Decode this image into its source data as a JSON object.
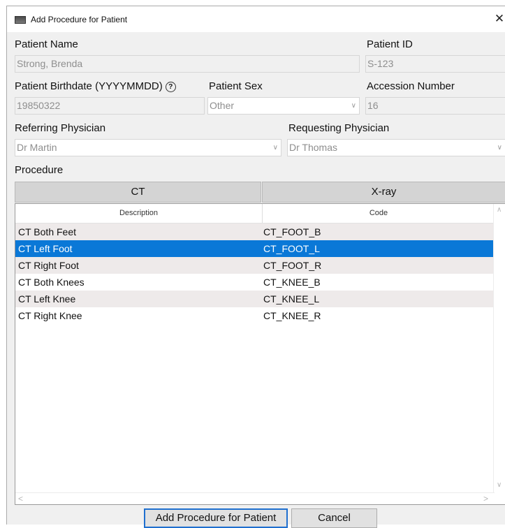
{
  "window": {
    "title": "Add Procedure for Patient",
    "close_glyph": "✕"
  },
  "patient": {
    "name_label": "Patient Name",
    "name_value": "Strong, Brenda",
    "id_label": "Patient ID",
    "id_value": "S-123",
    "birthdate_label": "Patient Birthdate (YYYYMMDD)",
    "birthdate_value": "19850322",
    "sex_label": "Patient Sex",
    "sex_value": "Other",
    "accession_label": "Accession Number",
    "accession_value": "16"
  },
  "physicians": {
    "referring_label": "Referring Physician",
    "referring_value": "Dr Martin",
    "requesting_label": "Requesting Physician",
    "requesting_value": "Dr Thomas"
  },
  "procedure": {
    "label": "Procedure",
    "tabs": [
      "CT",
      "X-ray"
    ],
    "columns": [
      "Description",
      "Code"
    ],
    "rows": [
      {
        "description": "CT Both Feet",
        "code": "CT_FOOT_B"
      },
      {
        "description": "CT Left Foot",
        "code": "CT_FOOT_L"
      },
      {
        "description": "CT Right Foot",
        "code": "CT_FOOT_R"
      },
      {
        "description": "CT Both Knees",
        "code": "CT_KNEE_B"
      },
      {
        "description": "CT Left Knee",
        "code": "CT_KNEE_L"
      },
      {
        "description": "CT Right Knee",
        "code": "CT_KNEE_R"
      }
    ],
    "selected_row": 1
  },
  "buttons": {
    "add": "Add Procedure for Patient",
    "cancel": "Cancel"
  },
  "icons": {
    "help": "help-circle-icon",
    "chevron": "chevron-down-icon",
    "app": "window-app-icon"
  },
  "colors": {
    "selection": "#0a78d7",
    "alt_row": "#eeeaea",
    "primary_border": "#1f6fcf"
  }
}
